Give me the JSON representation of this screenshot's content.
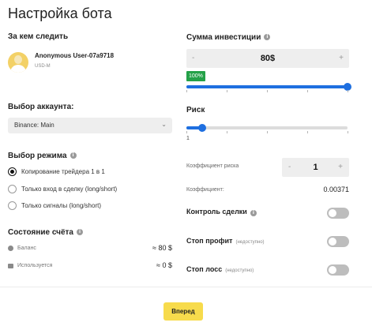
{
  "page": {
    "title": "Настройка бота"
  },
  "follow": {
    "label": "За кем следить",
    "user_name": "Anonymous User-07a9718",
    "user_sub": "USD-M"
  },
  "account": {
    "label": "Выбор аккаунта:",
    "selected": "Binance: Main"
  },
  "mode": {
    "label": "Выбор режима",
    "options": [
      {
        "label": "Копирование трейдера 1 в 1",
        "selected": true
      },
      {
        "label": "Только вход в сделку (long/short)",
        "selected": false
      },
      {
        "label": "Только сигналы (long/short)",
        "selected": false
      }
    ]
  },
  "account_state": {
    "label": "Состояние счёта",
    "balance_label": "Баланс",
    "balance_value": "≈ 80 $",
    "used_label": "Используется",
    "used_value": "≈ 0 $"
  },
  "investment": {
    "label": "Сумма инвестиции",
    "minus": "-",
    "plus": "+",
    "value": "80$",
    "percent_label": "100%",
    "percent": 100
  },
  "risk": {
    "label": "Риск",
    "min_label": "1",
    "level_fraction": 0.1
  },
  "risk_coef": {
    "label": "Коэффициент риска",
    "minus": "-",
    "plus": "+",
    "value": "1"
  },
  "coefficient": {
    "label": "Коэффициент:",
    "value": "0.00371"
  },
  "controls": {
    "deal_control": {
      "label": "Контроль сделки",
      "on": false
    },
    "stop_profit": {
      "label": "Стоп профит",
      "note": "(недоступно)",
      "on": false
    },
    "stop_loss": {
      "label": "Стоп лосс",
      "note": "(недоступно)",
      "on": false
    }
  },
  "footer": {
    "next_label": "Вперед"
  },
  "colors": {
    "accent_blue": "#1e6fe0",
    "badge_green": "#24a148",
    "button_yellow": "#f7db4c"
  },
  "icons": {
    "info": "info-icon",
    "balance": "coin-icon",
    "used": "lock-icon",
    "select": "chevron-down-icon"
  }
}
